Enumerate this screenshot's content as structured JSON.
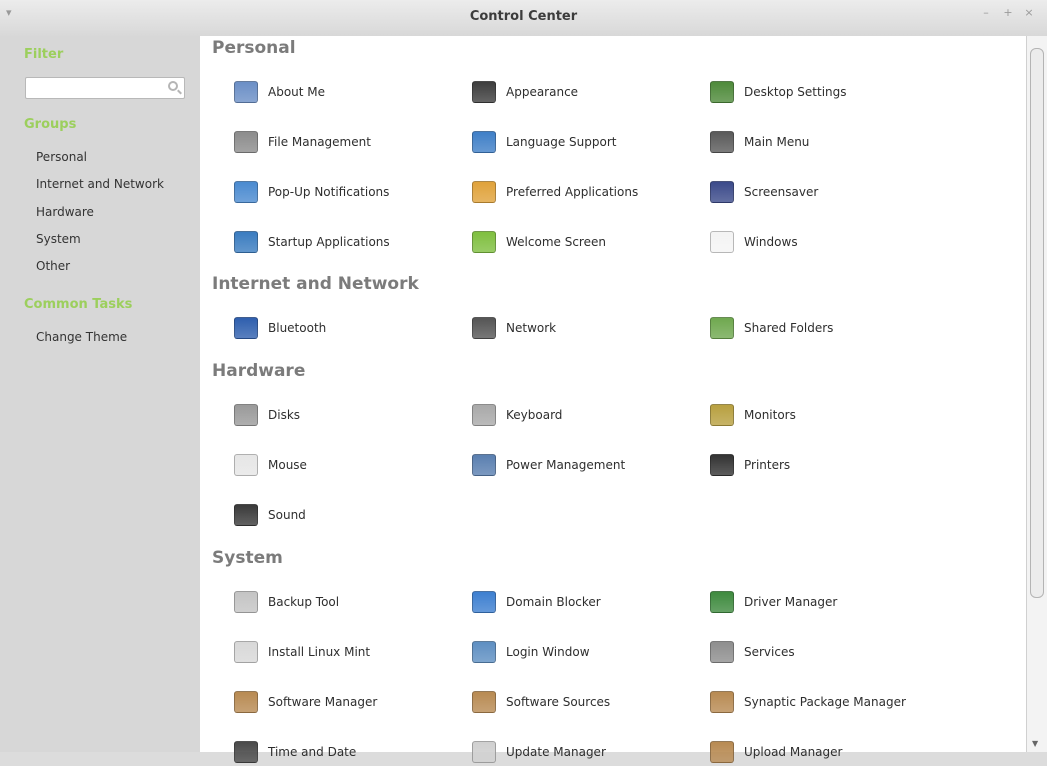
{
  "window": {
    "title": "Control Center"
  },
  "sidebar": {
    "filter_heading": "Filter",
    "filter_value": "",
    "groups_heading": "Groups",
    "groups": [
      "Personal",
      "Internet and Network",
      "Hardware",
      "System",
      "Other"
    ],
    "tasks_heading": "Common Tasks",
    "tasks": [
      "Change Theme"
    ]
  },
  "sections": [
    {
      "title": "Personal",
      "items": [
        {
          "label": "About Me",
          "icon": "about-me-icon",
          "color": "#6b8fc6"
        },
        {
          "label": "Appearance",
          "icon": "appearance-icon",
          "color": "#3d3d3d"
        },
        {
          "label": "Desktop Settings",
          "icon": "desktop-settings-icon",
          "color": "#4e8a3a"
        },
        {
          "label": "File Management",
          "icon": "file-management-icon",
          "color": "#8c8c8c"
        },
        {
          "label": "Language Support",
          "icon": "language-support-icon",
          "color": "#3f7fc7"
        },
        {
          "label": "Main Menu",
          "icon": "main-menu-icon",
          "color": "#5a5a5a"
        },
        {
          "label": "Pop-Up Notifications",
          "icon": "notifications-icon",
          "color": "#4a8ad0"
        },
        {
          "label": "Preferred Applications",
          "icon": "preferred-applications-icon",
          "color": "#e0a23a"
        },
        {
          "label": "Screensaver",
          "icon": "screensaver-icon",
          "color": "#3b4a8a"
        },
        {
          "label": "Startup Applications",
          "icon": "startup-applications-icon",
          "color": "#3a7cc0"
        },
        {
          "label": "Welcome Screen",
          "icon": "welcome-screen-icon",
          "color": "#7fbf3f"
        },
        {
          "label": "Windows",
          "icon": "windows-icon",
          "color": "#f4f4f4"
        }
      ]
    },
    {
      "title": "Internet and Network",
      "items": [
        {
          "label": "Bluetooth",
          "icon": "bluetooth-icon",
          "color": "#2f5fae"
        },
        {
          "label": "Network",
          "icon": "network-icon",
          "color": "#555555"
        },
        {
          "label": "Shared Folders",
          "icon": "shared-folders-icon",
          "color": "#6fa84f"
        }
      ]
    },
    {
      "title": "Hardware",
      "items": [
        {
          "label": "Disks",
          "icon": "disks-icon",
          "color": "#9a9a9a"
        },
        {
          "label": "Keyboard",
          "icon": "keyboard-icon",
          "color": "#a9a9a9"
        },
        {
          "label": "Monitors",
          "icon": "monitors-icon",
          "color": "#b8a040"
        },
        {
          "label": "Mouse",
          "icon": "mouse-icon",
          "color": "#e6e6e6"
        },
        {
          "label": "Power Management",
          "icon": "power-management-icon",
          "color": "#5a7fb0"
        },
        {
          "label": "Printers",
          "icon": "printers-icon",
          "color": "#333333"
        },
        {
          "label": "Sound",
          "icon": "sound-icon",
          "color": "#3a3a3a"
        }
      ]
    },
    {
      "title": "System",
      "items": [
        {
          "label": "Backup Tool",
          "icon": "backup-tool-icon",
          "color": "#c4c4c4"
        },
        {
          "label": "Domain Blocker",
          "icon": "domain-blocker-icon",
          "color": "#3d7fd0"
        },
        {
          "label": "Driver Manager",
          "icon": "driver-manager-icon",
          "color": "#3e8a3e"
        },
        {
          "label": "Install Linux Mint",
          "icon": "install-linux-mint-icon",
          "color": "#d8d8d8"
        },
        {
          "label": "Login Window",
          "icon": "login-window-icon",
          "color": "#5e8fc2"
        },
        {
          "label": "Services",
          "icon": "services-icon",
          "color": "#8e8e8e"
        },
        {
          "label": "Software Manager",
          "icon": "software-manager-icon",
          "color": "#b88a52"
        },
        {
          "label": "Software Sources",
          "icon": "software-sources-icon",
          "color": "#b88a52"
        },
        {
          "label": "Synaptic Package Manager",
          "icon": "synaptic-package-manager-icon",
          "color": "#b88a52"
        },
        {
          "label": "Time and Date",
          "icon": "time-and-date-icon",
          "color": "#4a4a4a"
        },
        {
          "label": "Update Manager",
          "icon": "update-manager-icon",
          "color": "#d0d0d0"
        },
        {
          "label": "Upload Manager",
          "icon": "upload-manager-icon",
          "color": "#b88a52"
        }
      ]
    }
  ]
}
